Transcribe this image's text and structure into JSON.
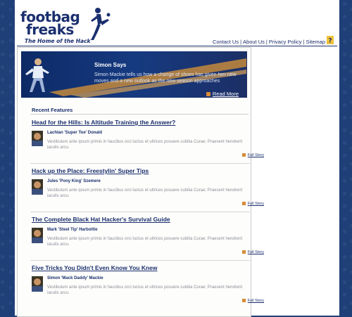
{
  "brand": {
    "logo_line1": "footbag",
    "logo_line2": "freaks",
    "tagline": "The Home of the Hack"
  },
  "topnav": {
    "items": [
      "Contact Us",
      "About Us",
      "Privacy Policy",
      "Sitemap"
    ],
    "separator": "|"
  },
  "banner": {
    "title": "Simon Says",
    "text": "Simon Mackie tells us how a change of shoes has given him new moves and a new outlook as the new season approaches",
    "more_label": "Read More"
  },
  "section": {
    "heading": "Recent Features"
  },
  "features": [
    {
      "title": "Head for the Hills: Is Altitude Training the Answer?",
      "author": "Lachlan 'Super Toe' Donald",
      "excerpt": "Vestibulum ante ipsum primis in faucibus orci luctus et ultrices posuere cubilia Curae; Praesent hendrerit iaculis arcu.",
      "link": "Full Story"
    },
    {
      "title": "Hack up the Place: Freestylin' Super Tips",
      "author": "Jules 'Pony King' Szemere",
      "excerpt": "Vestibulum ante ipsum primis in faucibus orci luctus et ultrices posuere cubilia Curae; Praesent hendrerit iaculis arcu.",
      "link": "Full Story"
    },
    {
      "title": "The Complete Black Hat Hacker's Survival Guide",
      "author": "Mark 'Steel Tip' Harbottle",
      "excerpt": "Vestibulum ante ipsum primis in faucibus orci luctus et ultrices posuere cubilia Curae; Praesent hendrerit iaculis arcu.",
      "link": "Full Story"
    },
    {
      "title": "Five Tricks You Didn't Even Know You Knew",
      "author": "Simon 'Mack Daddy' Mackie",
      "excerpt": "Vestibulum ante ipsum primis in faucibus orci luctus et ultrices posuere cubilia Curae; Praesent hendrerit iaculis arcu.",
      "link": "Full Story"
    }
  ],
  "colors": {
    "brand_navy": "#1a2f6e",
    "accent_orange": "#d98a3a",
    "outer_background": "#1f3f78"
  },
  "icons": {
    "help": "help-question-icon",
    "bullet": "orange-square-bullet-icon"
  }
}
